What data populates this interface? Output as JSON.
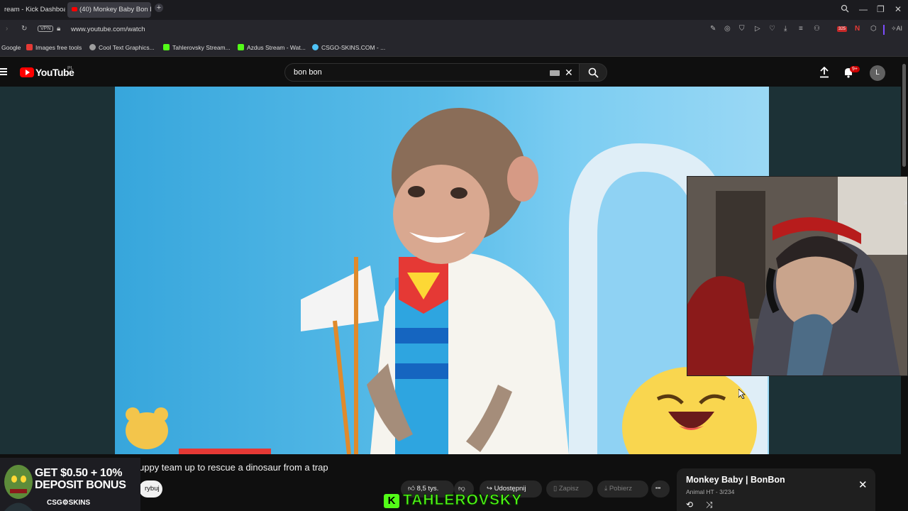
{
  "browser": {
    "tabs": [
      {
        "label": "ream - Kick Dashboard"
      },
      {
        "label": "(40) Monkey Baby Bon Bo"
      }
    ],
    "new_tab_icon": "plus-icon",
    "url": "www.youtube.com/watch",
    "vpn_label": "VPN",
    "extension_badge": "325",
    "ai_label": "AI",
    "bookmarks": [
      {
        "label": "Google",
        "color": "#4285f4"
      },
      {
        "label": "Images free tools",
        "color": "#e53935"
      },
      {
        "label": "Cool Text Graphics...",
        "color": "#9e9e9e"
      },
      {
        "label": "Tahlerovsky Stream...",
        "color": "#53fc18"
      },
      {
        "label": "Azdus Stream - Wat...",
        "color": "#53fc18"
      },
      {
        "label": "CSGO-SKINS.COM - ...",
        "color": "#4fc3f7"
      }
    ]
  },
  "youtube": {
    "logo_text": "YouTube",
    "region": "PL",
    "search_value": "bon bon",
    "notifications_badge": "9+",
    "avatar_letter": "L",
    "video_title": "uppy team up to rescue a dinosaur from a trap",
    "subscribe_partial": "rybuj",
    "like_count": "8,5 tys.",
    "share_label": "Udostępnij",
    "save_label": "Zapisz",
    "download_label": "Pobierz",
    "more_label": "•••",
    "playlist": {
      "title": "Monkey Baby | BonBon",
      "subtitle": "Animal HT - 3/234"
    }
  },
  "overlay": {
    "ad_line1": "GET $0.50 + 10%",
    "ad_line2": "DEPOSIT BONUS",
    "ad_brand": "CSG⚙SKINS",
    "streamer_badge": "K",
    "streamer_name": "TAHLEROVSKY"
  },
  "colors": {
    "kick_green": "#53fc18",
    "youtube_red": "#ff0000",
    "video_sky": "#5bbde9"
  }
}
